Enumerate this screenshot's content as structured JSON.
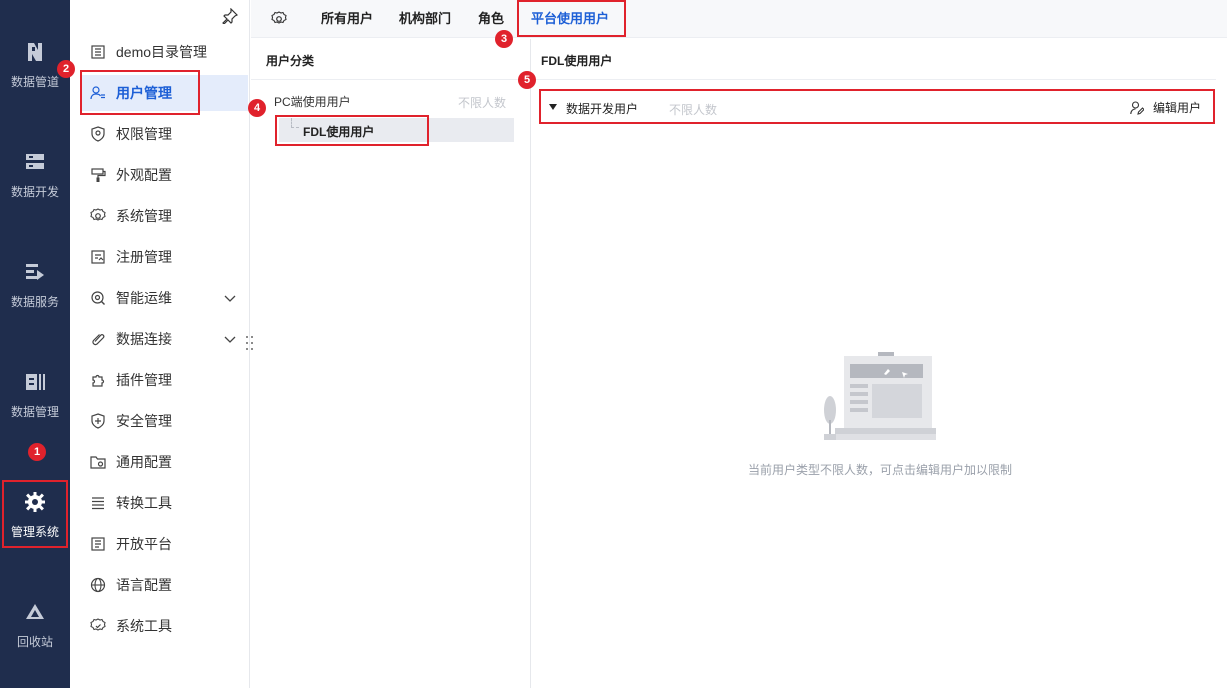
{
  "rail": {
    "items": [
      {
        "label": "数据管道",
        "icon": "pipeline-icon"
      },
      {
        "label": "数据开发",
        "icon": "dev-icon"
      },
      {
        "label": "数据服务",
        "icon": "service-icon"
      },
      {
        "label": "数据管理",
        "icon": "data-manage-icon"
      },
      {
        "label": "管理系统",
        "icon": "gear-icon"
      },
      {
        "label": "回收站",
        "icon": "recycle-icon"
      }
    ]
  },
  "menu": {
    "items": [
      {
        "label": "demo目录管理",
        "icon": "catalog-icon"
      },
      {
        "label": "用户管理",
        "icon": "user-icon"
      },
      {
        "label": "权限管理",
        "icon": "shield-icon"
      },
      {
        "label": "外观配置",
        "icon": "brush-icon"
      },
      {
        "label": "系统管理",
        "icon": "gear-icon"
      },
      {
        "label": "注册管理",
        "icon": "register-icon"
      },
      {
        "label": "智能运维",
        "icon": "ops-icon"
      },
      {
        "label": "数据连接",
        "icon": "link-icon"
      },
      {
        "label": "插件管理",
        "icon": "puzzle-icon"
      },
      {
        "label": "安全管理",
        "icon": "security-icon"
      },
      {
        "label": "通用配置",
        "icon": "folder-gear-icon"
      },
      {
        "label": "转换工具",
        "icon": "list-icon"
      },
      {
        "label": "开放平台",
        "icon": "doc-icon"
      },
      {
        "label": "语言配置",
        "icon": "globe-icon"
      },
      {
        "label": "系统工具",
        "icon": "tool-icon"
      }
    ]
  },
  "tabs": [
    {
      "label": "所有用户"
    },
    {
      "label": "机构部门"
    },
    {
      "label": "角色"
    },
    {
      "label": "平台使用用户"
    }
  ],
  "category": {
    "title": "用户分类",
    "parent": {
      "label": "PC端使用用户",
      "limit": "不限人数"
    },
    "child": {
      "label": "FDL使用用户"
    }
  },
  "detail": {
    "title": "FDL使用用户",
    "row": {
      "name": "数据开发用户",
      "limit": "不限人数",
      "edit_label": "编辑用户"
    },
    "empty_text": "当前用户类型不限人数，可点击编辑用户加以限制"
  },
  "badges": [
    "1",
    "2",
    "3",
    "4",
    "5"
  ],
  "colors": {
    "accent": "#1d5fd6",
    "highlight": "#e0222c",
    "rail_bg": "#1f2d4d"
  }
}
